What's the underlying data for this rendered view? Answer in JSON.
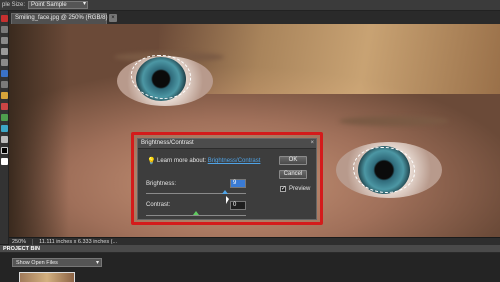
{
  "options_bar": {
    "sample_size_label": "ple Size:",
    "sample_size_value": "Point Sample"
  },
  "document": {
    "tab_title": "Smiling_face.jpg @ 250% (RGB/8) *",
    "close_glyph": "×"
  },
  "dialog": {
    "title": "Brightness/Contrast",
    "close_glyph": "×",
    "learn_prefix": "Learn more about:",
    "learn_link": "Brightness/Contrast",
    "brightness_label": "Brightness:",
    "brightness_value": "9",
    "contrast_label": "Contrast:",
    "contrast_value": "0",
    "ok_label": "OK",
    "cancel_label": "Cancel",
    "preview_label": "Preview",
    "preview_checked": true,
    "check_glyph": "✓",
    "bulb_glyph": "💡"
  },
  "status_bar": {
    "zoom": "250%",
    "doc_size": "11.111 inches x 6.333 inches (..."
  },
  "project_bin": {
    "title": "PROJECT BIN",
    "show_label": "Show Open Files"
  },
  "colors": {
    "highlight": "#d41b1b",
    "link": "#4fa3e6",
    "active_field": "#3a7bd5"
  }
}
